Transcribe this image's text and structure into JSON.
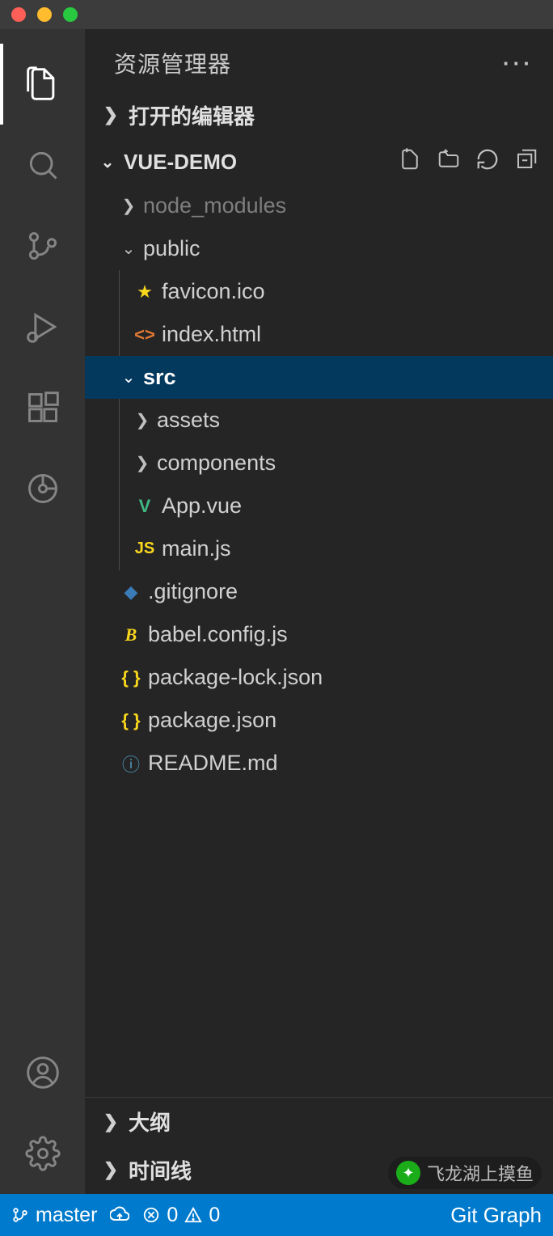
{
  "sidebar": {
    "title": "资源管理器",
    "sections": {
      "openEditors": "打开的编辑器",
      "folderName": "VUE-DEMO",
      "outline": "大纲",
      "timeline": "时间线"
    }
  },
  "tree": {
    "node_modules": "node_modules",
    "public": "public",
    "favicon": "favicon.ico",
    "indexhtml": "index.html",
    "src": "src",
    "assets": "assets",
    "components": "components",
    "appvue": "App.vue",
    "mainjs": "main.js",
    "gitignore": ".gitignore",
    "babel": "babel.config.js",
    "pkglock": "package-lock.json",
    "pkg": "package.json",
    "readme": "README.md"
  },
  "status": {
    "branch": "master",
    "errors": "0",
    "warnings": "0",
    "gitgraph": "Git Graph"
  },
  "watermark": "飞龙湖上摸鱼"
}
